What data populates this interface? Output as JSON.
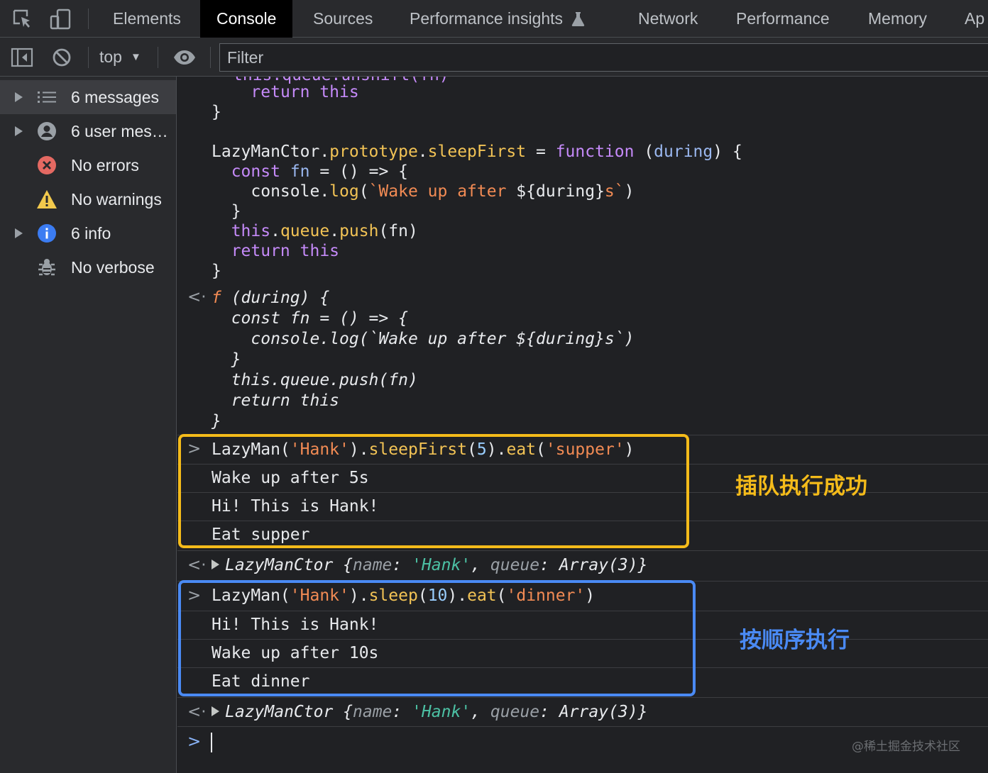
{
  "tabs": [
    {
      "label": "Elements",
      "active": false
    },
    {
      "label": "Console",
      "active": true
    },
    {
      "label": "Sources",
      "active": false
    },
    {
      "label": "Performance insights",
      "active": false
    },
    {
      "label": "Network",
      "active": false
    },
    {
      "label": "Performance",
      "active": false
    },
    {
      "label": "Memory",
      "active": false
    },
    {
      "label": "Ap",
      "active": false
    }
  ],
  "toolbar": {
    "context": "top",
    "filter_placeholder": "Filter"
  },
  "sidebar": {
    "items": [
      {
        "label": "6 messages",
        "icon": "list-icon",
        "expandable": true,
        "selected": true
      },
      {
        "label": "6 user mes…",
        "icon": "user-icon",
        "expandable": true,
        "selected": false
      },
      {
        "label": "No errors",
        "icon": "error-icon",
        "expandable": false,
        "selected": false
      },
      {
        "label": "No warnings",
        "icon": "warning-icon",
        "expandable": false,
        "selected": false
      },
      {
        "label": "6 info",
        "icon": "info-icon",
        "expandable": true,
        "selected": false
      },
      {
        "label": "No verbose",
        "icon": "bug-icon",
        "expandable": false,
        "selected": false
      }
    ]
  },
  "console": {
    "partial_top": "this.queue.unshift(fn)",
    "block1": [
      "  return this",
      "}",
      "",
      "LazyManCtor.prototype.sleepFirst = function (during) {",
      "  const fn = () => {",
      "    console.log(`Wake up after ${during}s`)",
      "  }",
      "  this.queue.push(fn)",
      "  return this",
      "}"
    ],
    "result1": [
      "f (during) {",
      "  const fn = () => {",
      "    console.log(`Wake up after ${during}s`)",
      "  }",
      "  this.queue.push(fn)",
      "  return this",
      "}"
    ],
    "cmd1": "LazyMan('Hank').sleepFirst(5).eat('supper')",
    "out1": [
      "Wake up after 5s",
      "Hi! This is Hank!",
      "Eat supper"
    ],
    "ret1": "LazyManCtor {name: 'Hank', queue: Array(3)}",
    "cmd2": "LazyMan('Hank').sleep(10).eat('dinner')",
    "out2": [
      "Hi! This is Hank!",
      "Wake up after 10s",
      "Eat dinner"
    ],
    "ret2": "LazyManCtor {name: 'Hank', queue: Array(3)}"
  },
  "annotations": {
    "note1": "插队执行成功",
    "note2": "按顺序执行",
    "color_note1": "#f4bb1a",
    "color_note2": "#4a8af4"
  },
  "watermark": "@稀土掘金技术社区",
  "colors": {
    "keyword": "#c58af9",
    "property": "#f2c355",
    "string": "#f28b54",
    "number": "#99ceff",
    "active_tab_bg": "#000000"
  }
}
